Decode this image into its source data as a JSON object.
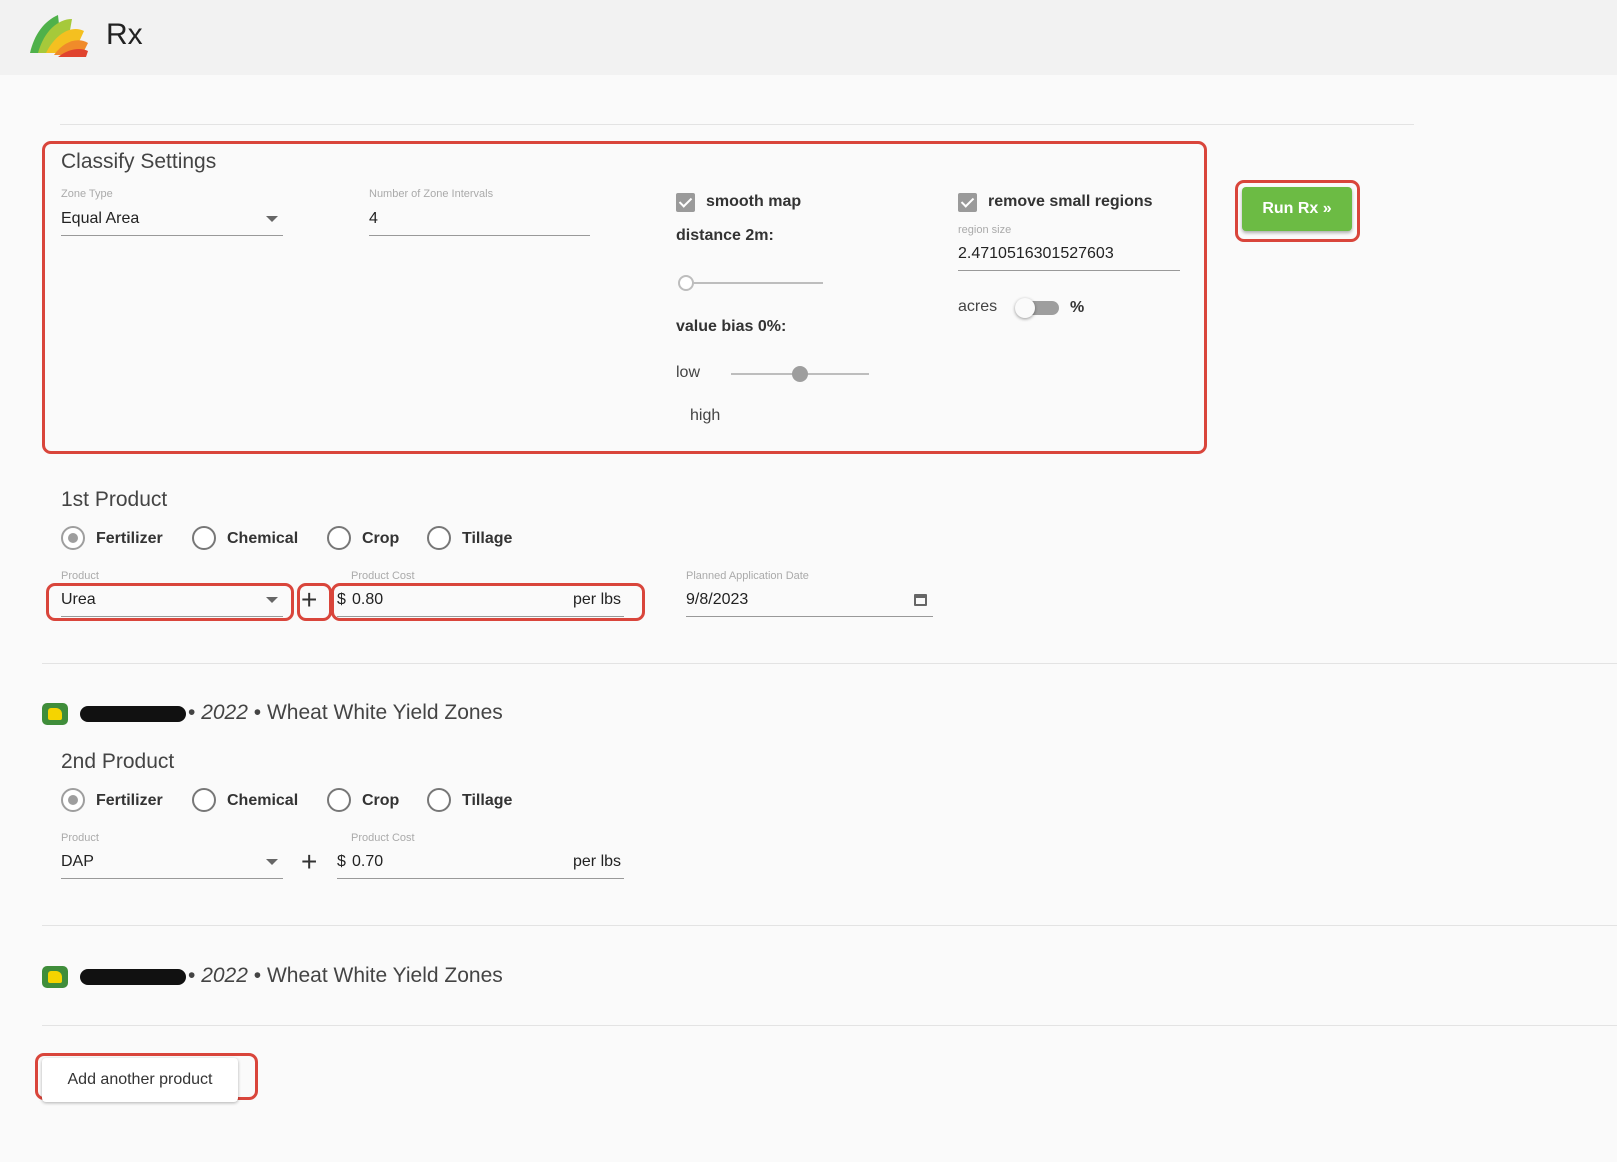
{
  "app": {
    "title": "Rx",
    "logo_icon": "fan-leaf-logo"
  },
  "classify": {
    "title": "Classify Settings",
    "zone_type": {
      "label": "Zone Type",
      "value": "Equal Area"
    },
    "zone_intervals": {
      "label": "Number of Zone Intervals",
      "value": "4"
    },
    "smooth_map": {
      "label": "smooth map",
      "checked": true
    },
    "distance": {
      "label": "distance 2m:",
      "value": 0
    },
    "value_bias": {
      "label": "value bias 0%:",
      "low_label": "low",
      "high_label": "high",
      "value": 0.5
    },
    "remove_small": {
      "label": "remove small regions",
      "checked": true
    },
    "region_size": {
      "label": "region size",
      "value": "2.4710516301527603"
    },
    "units": {
      "left": "acres",
      "right": "%",
      "toggle_on": true
    }
  },
  "run_button": {
    "label": "Run Rx »",
    "color": "#6cbb44"
  },
  "products": [
    {
      "title": "1st Product",
      "types": [
        "Fertilizer",
        "Chemical",
        "Crop",
        "Tillage"
      ],
      "selected": "Fertilizer",
      "product_label": "Product",
      "product_value": "Urea",
      "cost_label": "Product Cost",
      "cost_prefix": "$",
      "cost_value": "0.80",
      "cost_unit": "per lbs",
      "date_label": "Planned Application Date",
      "date_value": "9/8/2023",
      "layer": {
        "year": "2022",
        "name": "Wheat White Yield Zones"
      }
    },
    {
      "title": "2nd Product",
      "types": [
        "Fertilizer",
        "Chemical",
        "Crop",
        "Tillage"
      ],
      "selected": "Fertilizer",
      "product_label": "Product",
      "product_value": "DAP",
      "cost_label": "Product Cost",
      "cost_prefix": "$",
      "cost_value": "0.70",
      "cost_unit": "per lbs",
      "layer": {
        "year": "2022",
        "name": "Wheat White Yield Zones"
      }
    }
  ],
  "bullet": "•",
  "add_product": {
    "label": "Add another product"
  },
  "highlight_color": "#d9453b"
}
